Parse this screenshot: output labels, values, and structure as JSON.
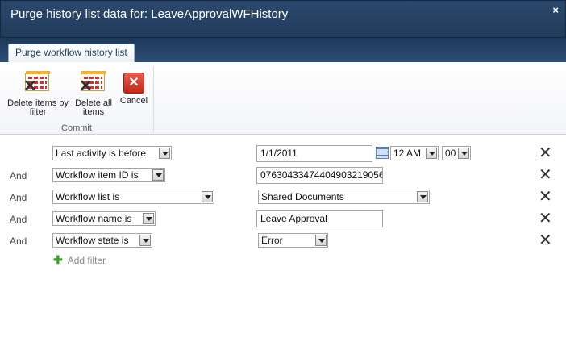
{
  "dialog": {
    "title": "Purge history list data for: LeaveApprovalWFHistory",
    "close_label": "×"
  },
  "tab": {
    "label": "Purge workflow history list"
  },
  "ribbon": {
    "delete_by_filter_label_1": "Delete items by",
    "delete_by_filter_label_2": "filter",
    "delete_all_label_1": "Delete all",
    "delete_all_label_2": "items",
    "cancel_label": "Cancel",
    "group_label": "Commit"
  },
  "filters": [
    {
      "conjunction": "",
      "field": "Last activity is before",
      "value": "1/1/2011",
      "hour": "12 AM",
      "minute": "00"
    },
    {
      "conjunction": "And",
      "field": "Workflow item ID is",
      "value": "07630433474404903219056"
    },
    {
      "conjunction": "And",
      "field": "Workflow list is",
      "value": "Shared Documents"
    },
    {
      "conjunction": "And",
      "field": "Workflow name is",
      "value": "Leave Approval"
    },
    {
      "conjunction": "And",
      "field": "Workflow state is",
      "value": "Error"
    }
  ],
  "add_filter_label": "Add filter",
  "icons": {
    "close": "close-icon",
    "remove": "remove-filter-icon",
    "calendar": "calendar-icon",
    "add": "plus-icon"
  }
}
